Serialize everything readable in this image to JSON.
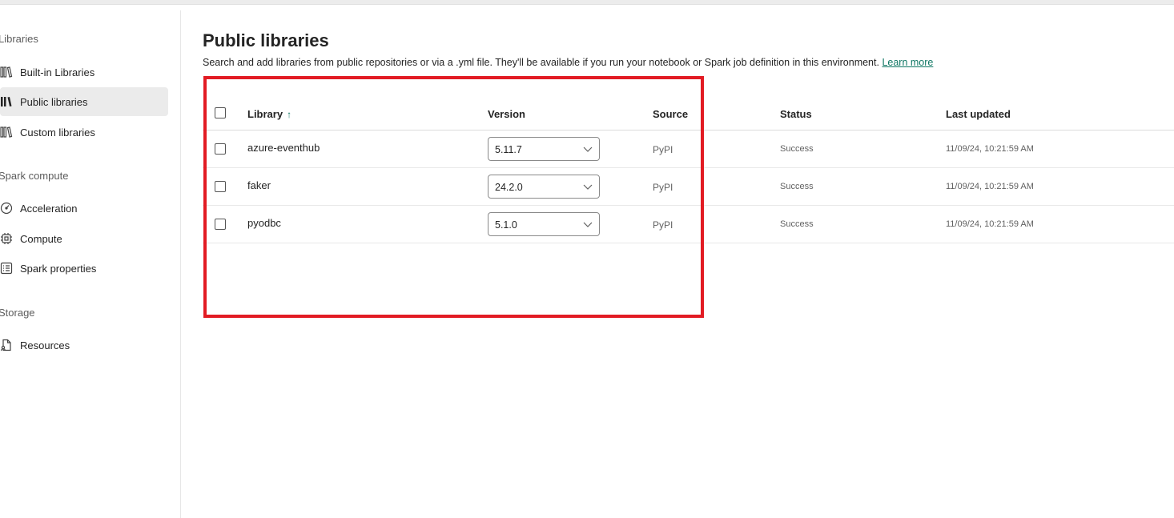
{
  "sidebar": {
    "sections": [
      {
        "title": "Libraries",
        "items": [
          {
            "label": "Built-in Libraries",
            "icon": "library-books-icon"
          },
          {
            "label": "Public libraries",
            "icon": "public-library-icon",
            "selected": true
          },
          {
            "label": "Custom libraries",
            "icon": "custom-library-icon"
          }
        ]
      },
      {
        "title": "Spark compute",
        "items": [
          {
            "label": "Acceleration",
            "icon": "gauge-icon"
          },
          {
            "label": "Compute",
            "icon": "chip-icon"
          },
          {
            "label": "Spark properties",
            "icon": "properties-list-icon"
          }
        ]
      },
      {
        "title": "Storage",
        "items": [
          {
            "label": "Resources",
            "icon": "document-person-icon"
          }
        ]
      }
    ]
  },
  "main": {
    "title": "Public libraries",
    "description": "Search and add libraries from public repositories or via a .yml file. They'll be available if you run your notebook or Spark job definition in this environment.",
    "learn_more": "Learn more",
    "table": {
      "headers": {
        "library": "Library",
        "sort_arrow": "↑",
        "version": "Version",
        "source": "Source",
        "status": "Status",
        "last_updated": "Last updated"
      },
      "rows": [
        {
          "library": "azure-eventhub",
          "version": "5.11.7",
          "source": "PyPI",
          "status": "Success",
          "last_updated": "11/09/24, 10:21:59 AM"
        },
        {
          "library": "faker",
          "version": "24.2.0",
          "source": "PyPI",
          "status": "Success",
          "last_updated": "11/09/24, 10:21:59 AM"
        },
        {
          "library": "pyodbc",
          "version": "5.1.0",
          "source": "PyPI",
          "status": "Success",
          "last_updated": "11/09/24, 10:21:59 AM"
        }
      ]
    }
  },
  "colors": {
    "accent": "#117865",
    "highlight_border": "#e21b23",
    "selected_bg": "#ebebeb"
  }
}
